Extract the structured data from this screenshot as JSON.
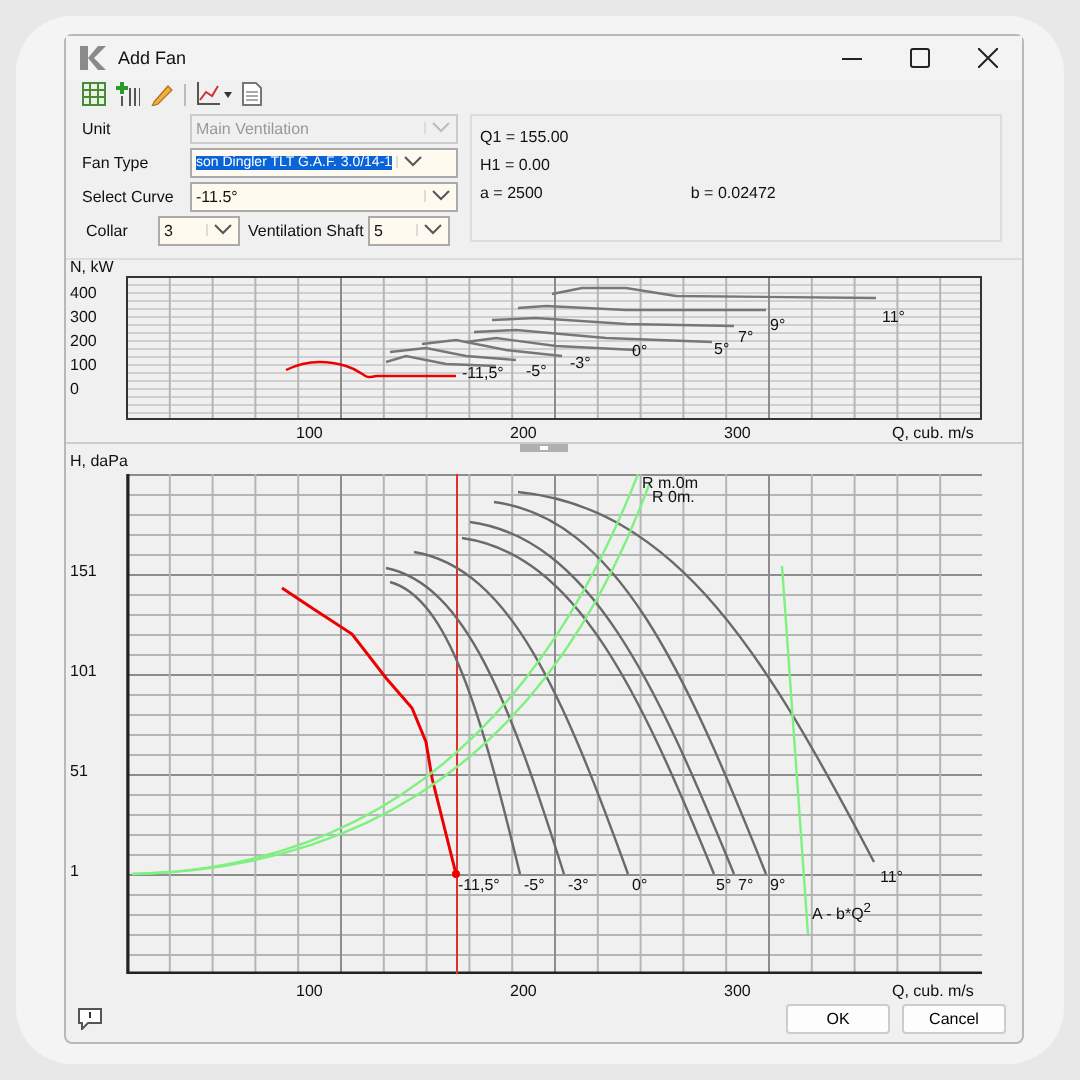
{
  "window": {
    "title": "Add Fan"
  },
  "fields": [
    {
      "label": "Unit",
      "value": "Main Ventilation",
      "disabled": true,
      "text_selected": false
    },
    {
      "label": "Fan Type",
      "value": "son Dingler TLT G.A.F. 3.0/14-1",
      "disabled": false,
      "text_selected": true
    },
    {
      "label": "Select Curve",
      "value": "-11.5°",
      "disabled": false,
      "text_selected": false
    }
  ],
  "collar": {
    "label": "Collar",
    "value": "3"
  },
  "ventilation_shaft": {
    "label": "Ventilation Shaft",
    "value": "5"
  },
  "info": {
    "q1": "Q1 = 155.00",
    "h1": "H1 = 0.00",
    "a": "a = 2500",
    "b": "b = 0.02472"
  },
  "power_chart": {
    "ylabel": "N, kW",
    "xlabel": "Q, cub. m/s",
    "yticks": [
      "400",
      "300",
      "200",
      "100",
      "0"
    ],
    "xticks": [
      "100",
      "200",
      "300"
    ],
    "curve_labels": [
      "-11,5°",
      "-5°",
      "-3°",
      "0°",
      "5°",
      "7°",
      "9°",
      "11°"
    ]
  },
  "pressure_chart": {
    "ylabel": "H, daPa",
    "xlabel": "Q, cub. m/s",
    "yticks": [
      "151",
      "101",
      "51",
      "1"
    ],
    "xticks": [
      "100",
      "200",
      "300"
    ],
    "curve_labels": [
      "-11,5°",
      "-5°",
      "-3°",
      "0°",
      "5°",
      "7°",
      "9°",
      "11°"
    ],
    "network_labels": [
      "R m.0m",
      "R 0m."
    ],
    "characteristic_label": "A - b*Q$^{2}$"
  },
  "buttons": [
    {
      "label": "OK"
    },
    {
      "label": "Cancel"
    }
  ]
}
